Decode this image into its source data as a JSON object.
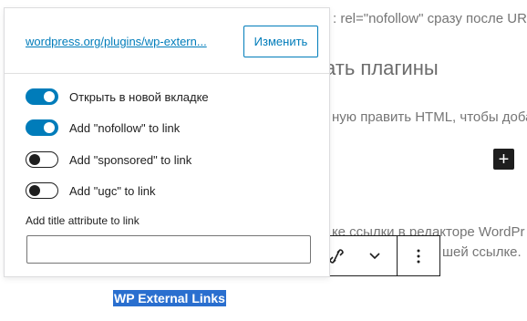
{
  "background": {
    "line1": ": rel=\"nofollow\" сразу после URL",
    "heading": "ать плагины",
    "line2": "ную править HTML, чтобы доба",
    "line3": "кe ссылки в редакторе WordPr",
    "line4": "шей ссылке."
  },
  "selected_text": "WP External Links",
  "link_popover": {
    "url": "wordpress.org/plugins/wp-extern...",
    "edit_label": "Изменить",
    "toggles": [
      {
        "label": "Открыть в новой вкладке",
        "on": true
      },
      {
        "label": "Add \"nofollow\" to link",
        "on": true
      },
      {
        "label": "Add \"sponsored\" to link",
        "on": false
      },
      {
        "label": "Add \"ugc\" to link",
        "on": false
      }
    ],
    "title_attr_label": "Add title attribute to link",
    "title_attr_value": ""
  },
  "toolbar": {
    "icons": [
      "unlink-icon",
      "chevron-down-icon",
      "more-vertical-icon"
    ]
  },
  "colors": {
    "accent": "#007cba",
    "selection": "#2a6fcf",
    "dark": "#1e1e1e"
  }
}
